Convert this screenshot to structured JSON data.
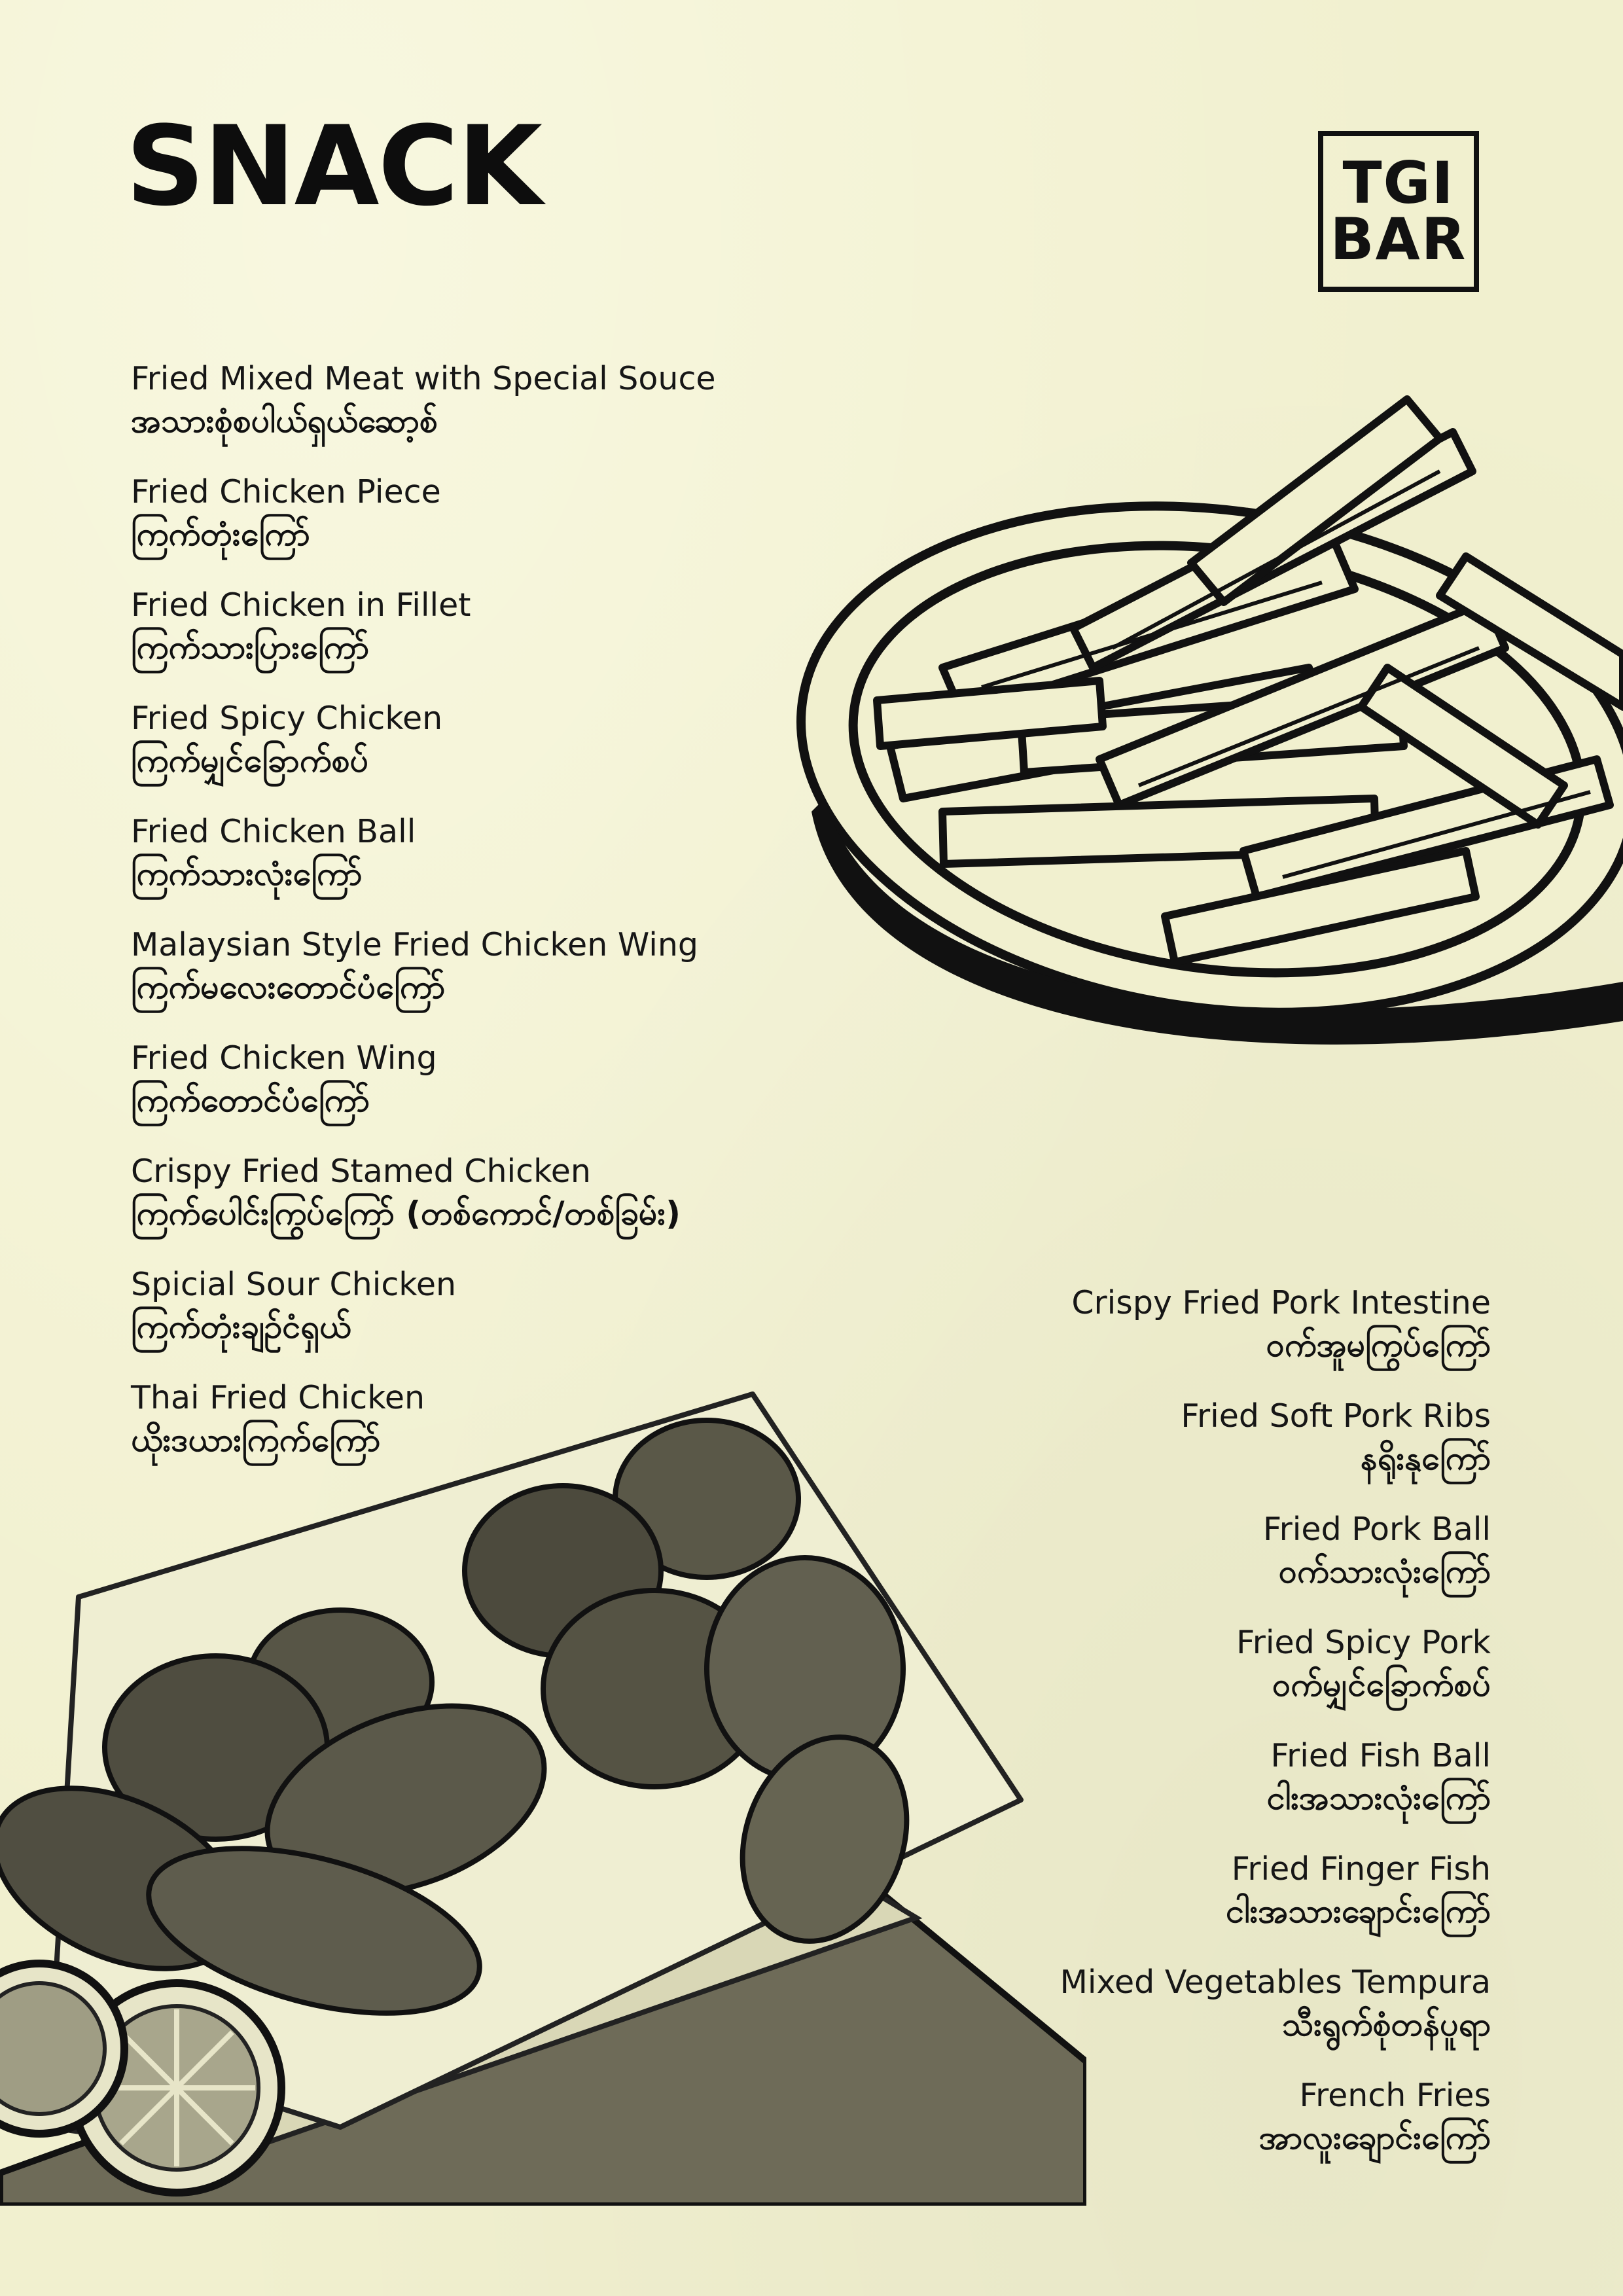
{
  "header": {
    "title": "SNACK"
  },
  "logo": {
    "line1": "TGI",
    "line2": "BAR"
  },
  "menu_left": [
    {
      "en": "Fried Mixed Meat with Special Souce",
      "mm": "အသားစုံစပါယ်ရှယ်ဆော့စ်"
    },
    {
      "en": "Fried Chicken Piece",
      "mm": "ကြက်တုံးကြော်"
    },
    {
      "en": "Fried Chicken in Fillet",
      "mm": "ကြက်သားပြားကြော်"
    },
    {
      "en": "Fried Spicy Chicken",
      "mm": "ကြက်မျှင်ခြောက်စပ်"
    },
    {
      "en": "Fried Chicken Ball",
      "mm": "ကြက်သားလုံးကြော်"
    },
    {
      "en": "Malaysian Style Fried Chicken Wing",
      "mm": "ကြက်မလေးတောင်ပံကြော်"
    },
    {
      "en": "Fried Chicken Wing",
      "mm": "ကြက်တောင်ပံကြော်"
    },
    {
      "en": "Crispy Fried Stamed Chicken",
      "mm": "ကြက်ပေါင်းကြွပ်ကြော် (တစ်ကောင်/တစ်ခြမ်း)"
    },
    {
      "en": "Spicial Sour Chicken",
      "mm": "ကြက်တုံးချဥ်ငံရှယ်"
    },
    {
      "en": "Thai Fried Chicken",
      "mm": "ယိုးဒယားကြက်ကြော်"
    }
  ],
  "menu_right": [
    {
      "en": "Crispy Fried Pork Intestine",
      "mm": "ဝက်အူမကြွပ်ကြော်"
    },
    {
      "en": "Fried Soft Pork Ribs",
      "mm": "နရိုးနုကြော်"
    },
    {
      "en": "Fried Pork Ball",
      "mm": "ဝက်သားလုံးကြော်"
    },
    {
      "en": "Fried Spicy Pork",
      "mm": "ဝက်မျှင်ခြောက်စပ်"
    },
    {
      "en": "Fried Fish Ball",
      "mm": "ငါးအသားလုံးကြော်"
    },
    {
      "en": "Fried Finger Fish",
      "mm": "ငါးအသားချောင်းကြော်"
    },
    {
      "en": "Mixed Vegetables Tempura",
      "mm": "သီးရွက်စုံတန်ပူရာ"
    },
    {
      "en": "French Fries",
      "mm": "အာလူးချောင်းကြော်"
    }
  ]
}
